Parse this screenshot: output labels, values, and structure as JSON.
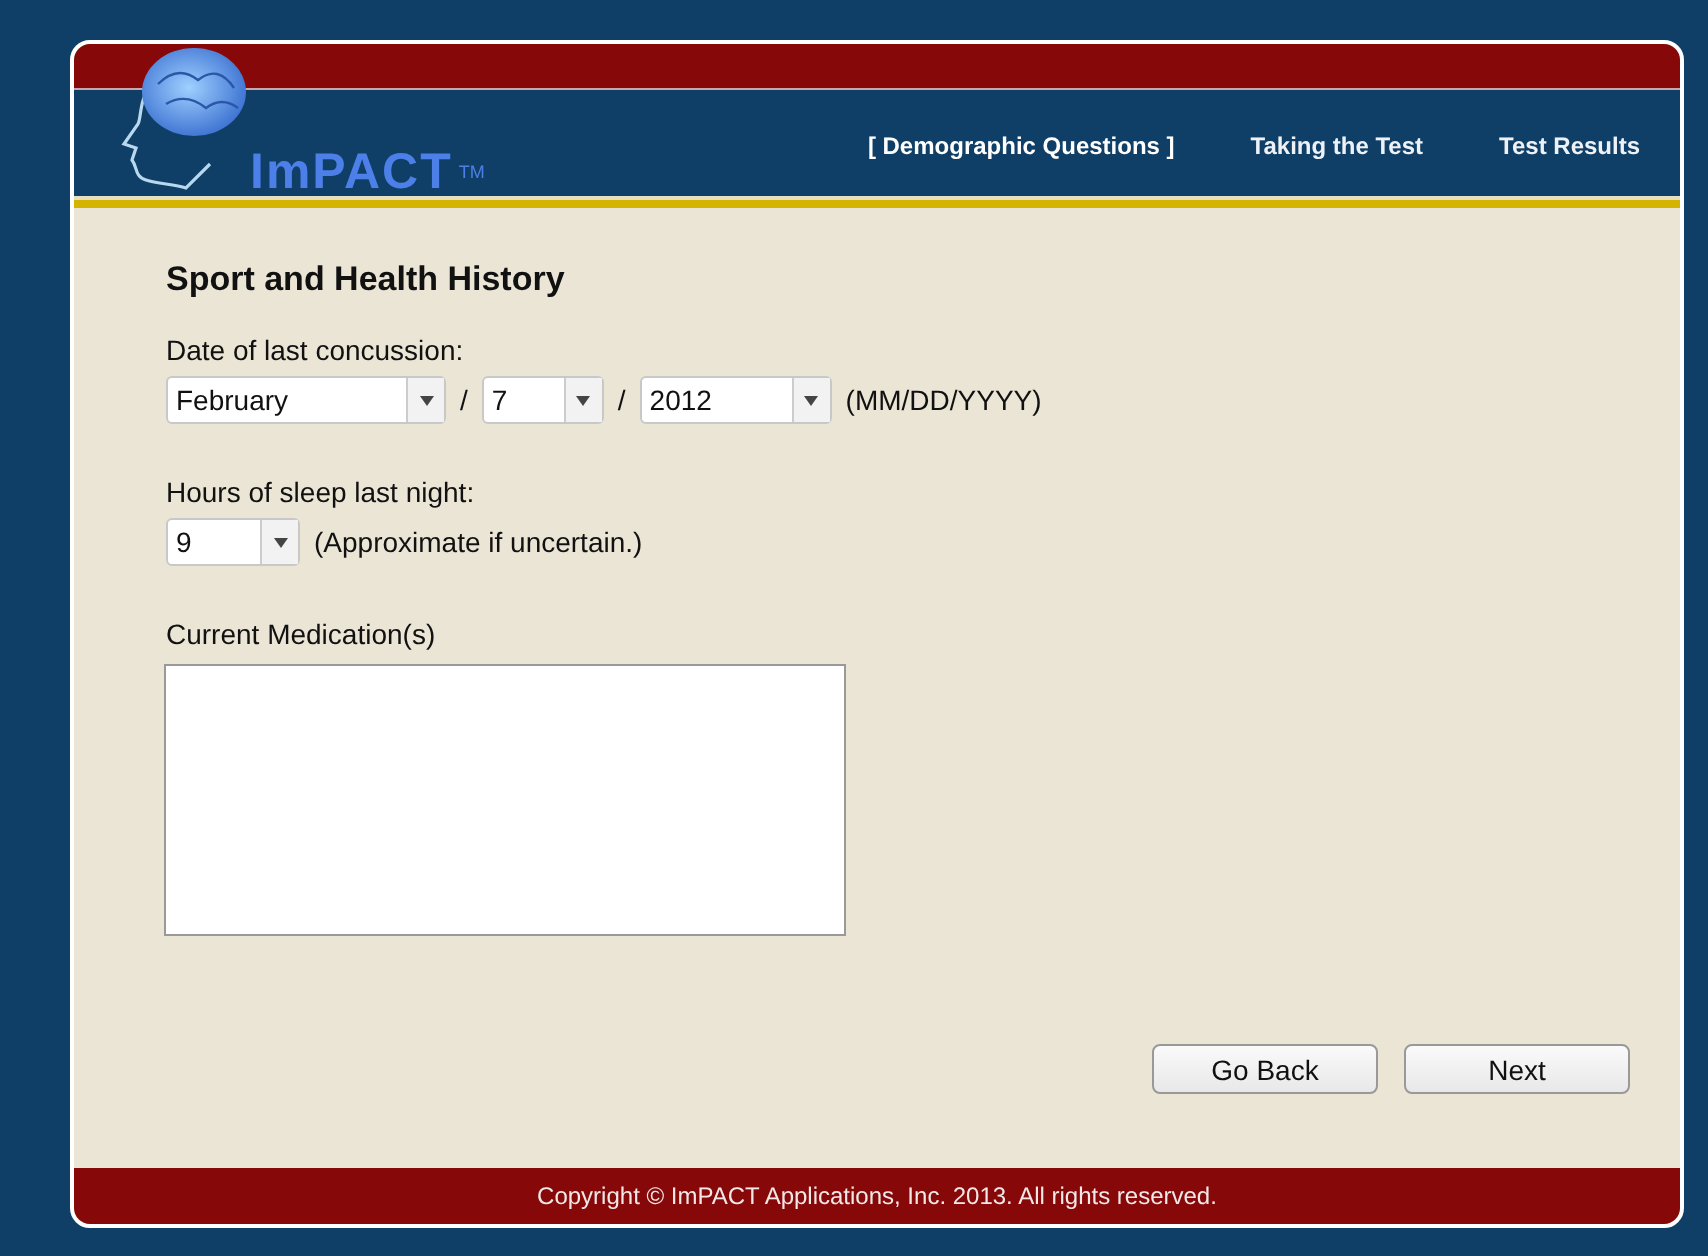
{
  "logo": {
    "name": "ImPACT",
    "mark": "TM"
  },
  "nav": [
    {
      "label": "[ Demographic Questions ]",
      "selected": true
    },
    {
      "label": "Taking the Test",
      "selected": false
    },
    {
      "label": "Test Results",
      "selected": false
    }
  ],
  "heading": "Sport and Health History",
  "concussion": {
    "label": "Date of last concussion:",
    "month": "February",
    "separator_1": "/",
    "day": "7",
    "separator_2": "/",
    "year": "2012",
    "format": "(MM/DD/YYYY)"
  },
  "sleep": {
    "label": "Hours of sleep last night:",
    "value": "9",
    "hint": "(Approximate if uncertain.)"
  },
  "medication": {
    "label": "Current Medication(s)"
  },
  "buttons": [
    "Go Back",
    "Next"
  ],
  "footer": "Copyright © ImPACT Applications, Inc. 2013. All rights reserved."
}
